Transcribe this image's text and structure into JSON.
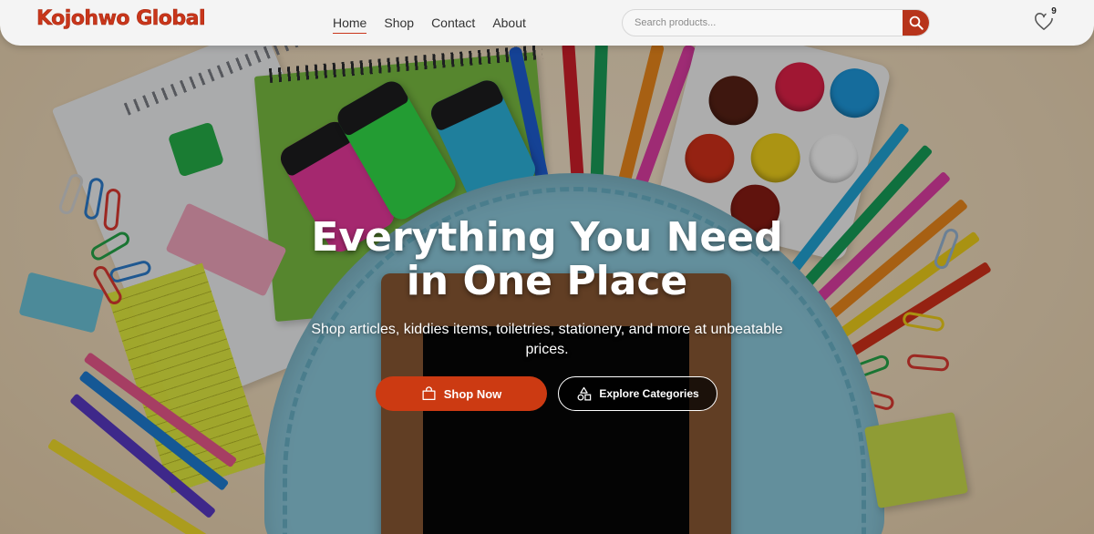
{
  "brand": {
    "name": "Kojohwo Global",
    "accent": "#c9361b"
  },
  "nav": {
    "items": [
      {
        "label": "Home",
        "active": true
      },
      {
        "label": "Shop",
        "active": false
      },
      {
        "label": "Contact",
        "active": false
      },
      {
        "label": "About",
        "active": false
      }
    ]
  },
  "search": {
    "placeholder": "Search products...",
    "value": "",
    "icon": "search-icon",
    "button_color": "#b7341b"
  },
  "wishlist": {
    "icon": "heart-icon",
    "count": "9"
  },
  "hero": {
    "title_line1": "Everything You Need",
    "title_line2": "in One Place",
    "subtitle": "Shop articles, kiddies items, toiletries, stationery, and more at unbeatable prices.",
    "primary_button": {
      "label": "Shop Now",
      "icon": "shopping-bag-icon",
      "color": "#cc3a12"
    },
    "secondary_button": {
      "label": "Explore Categories",
      "icon": "shapes-icon"
    },
    "background": "school-supplies-backpack-photo"
  }
}
